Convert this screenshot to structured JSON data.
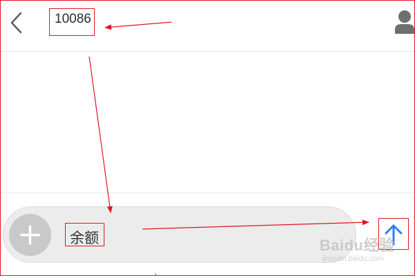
{
  "header": {
    "title": "10086",
    "back_icon": "chevron-left-icon",
    "contact_icon": "person-icon"
  },
  "composer": {
    "input_value": "余额",
    "attach_icon": "plus-icon",
    "send_icon": "arrow-up-icon"
  },
  "watermark": {
    "brand": "Baidu经验",
    "url": "jingyan.baidu.com"
  },
  "colors": {
    "annotation_red": "#e0141e",
    "send_blue": "#2f7cf6",
    "icon_gray": "#6f6f6f",
    "pill_gray": "#ececec",
    "plus_bg": "#c9c9c9"
  }
}
